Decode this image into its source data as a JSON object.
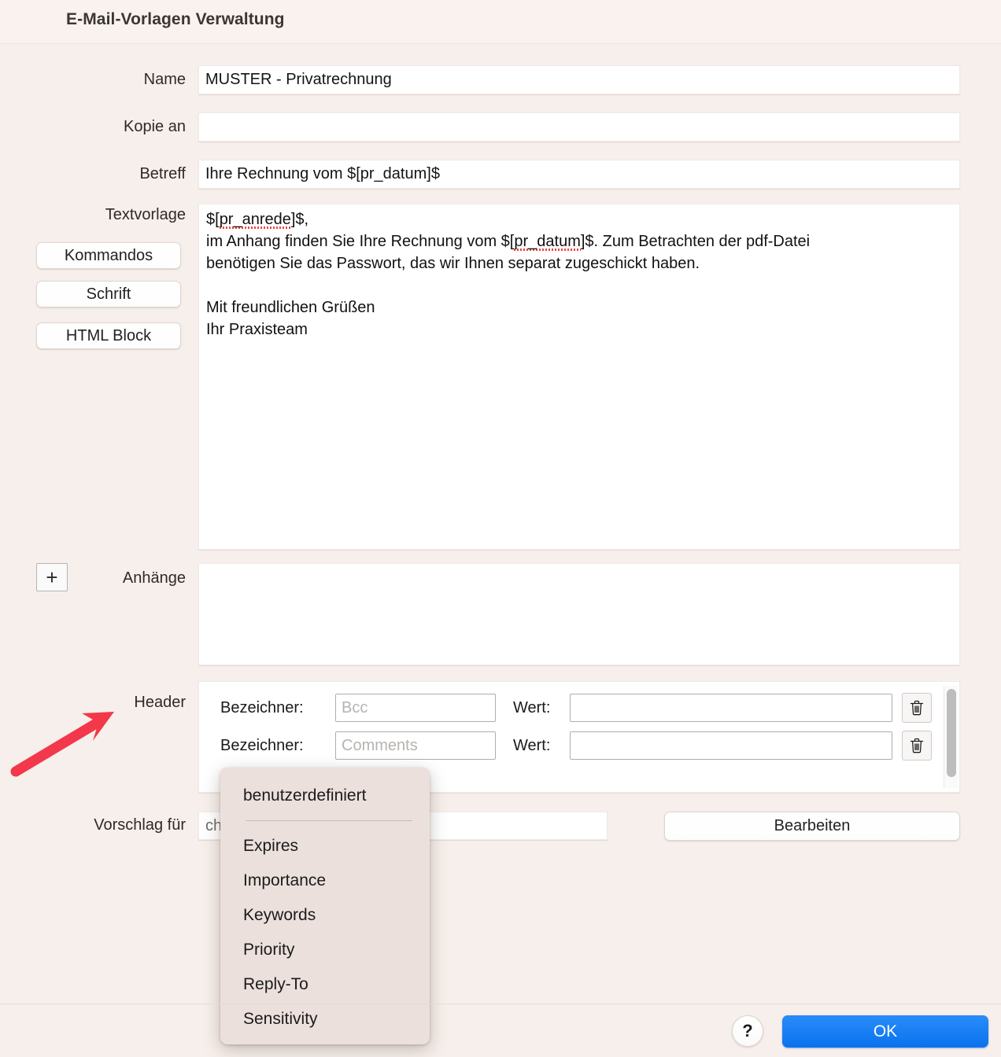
{
  "window": {
    "title": "E-Mail-Vorlagen Verwaltung"
  },
  "form": {
    "name": {
      "label": "Name",
      "value": "MUSTER - Privatrechnung",
      "placeholder": ""
    },
    "kopie_an": {
      "label": "Kopie an",
      "value": "",
      "placeholder": ""
    },
    "betreff": {
      "label": "Betreff",
      "value": "Ihre Rechnung vom $[pr_datum]$",
      "placeholder": ""
    },
    "textvorlage": {
      "label": "Textvorlage",
      "line1_a": "$[",
      "line1_b": "pr_anrede",
      "line1_c": "]$,",
      "line2_a": "im Anhang finden Sie Ihre Rechnung vom $[",
      "line2_b": "pr_datum",
      "line2_c": "]$. Zum Betrachten der pdf-Datei",
      "line3": "benötigen Sie das Passwort, das wir Ihnen separat zugeschickt haben.",
      "line4": "",
      "line5": "Mit freundlichen Grüßen",
      "line6": "Ihr Praxisteam"
    },
    "anhaenge": {
      "label": "Anhänge",
      "add_button": "+",
      "items": []
    },
    "header": {
      "label": "Header"
    },
    "vorschlag": {
      "label": "Vorschlag für",
      "value": "chnung",
      "edit_button": "Bearbeiten"
    }
  },
  "side_buttons": [
    {
      "label": "Kommandos"
    },
    {
      "label": "Schrift"
    },
    {
      "label": "HTML Block"
    }
  ],
  "header_rows": [
    {
      "bezeichner_label": "Bezeichner:",
      "bezeichner_value": "",
      "bezeichner_placeholder": "Bcc",
      "wert_label": "Wert:",
      "wert_value": "",
      "delete_icon": "trash-icon"
    },
    {
      "bezeichner_label": "Bezeichner:",
      "bezeichner_value": "",
      "bezeichner_placeholder": "Comments",
      "wert_label": "Wert:",
      "wert_value": "",
      "delete_icon": "trash-icon"
    }
  ],
  "popup_menu": {
    "selected": "benutzerdefiniert",
    "items": [
      {
        "label": "Expires"
      },
      {
        "label": "Importance"
      },
      {
        "label": "Keywords"
      },
      {
        "label": "Priority"
      },
      {
        "label": "Reply-To"
      },
      {
        "label": "Sensitivity"
      }
    ]
  },
  "footer": {
    "help_label": "?",
    "ok_label": "OK"
  },
  "annotation": {
    "arrow": "red-arrow-pointing-to-header-label",
    "color": "#f2384a"
  },
  "colors": {
    "background": "#f7efeb",
    "titlebar": "#faf2ee",
    "accent_ok": "#1a80f5",
    "menu_background": "#ebe0dc",
    "arrow_red": "#f2384a"
  }
}
